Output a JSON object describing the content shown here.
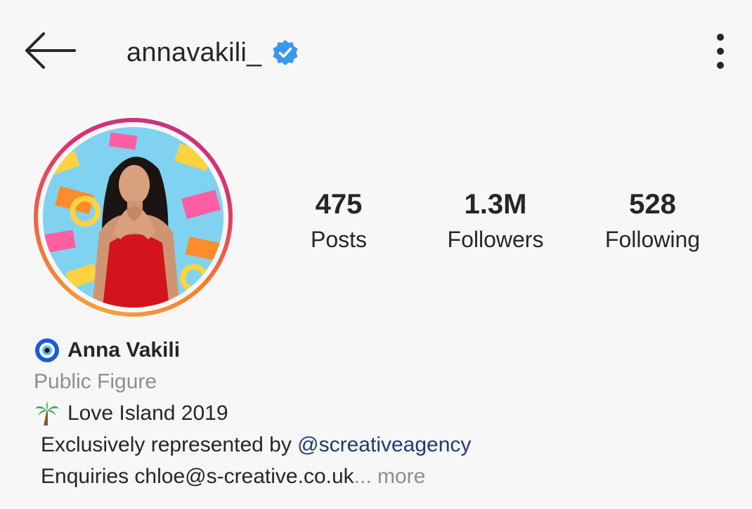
{
  "header": {
    "username": "annavakili_",
    "verified": true,
    "back_icon": "arrow-left-icon",
    "menu_icon": "more-vertical-icon",
    "verified_color": "#3897f0"
  },
  "profile": {
    "avatar_alt": "Anna Vakili profile photo",
    "story_ring_colors": [
      "#f9a03f",
      "#f06d3a",
      "#e1306c",
      "#c13584"
    ]
  },
  "stats": [
    {
      "value": "475",
      "label": "Posts"
    },
    {
      "value": "1.3M",
      "label": "Followers"
    },
    {
      "value": "528",
      "label": "Following"
    }
  ],
  "bio": {
    "name_emoji_icon": "nazar-amulet-icon",
    "name": "Anna Vakili",
    "category": "Public Figure",
    "line1_emoji_icon": "palm-tree-icon",
    "line1": "Love Island 2019",
    "line2_prefix": "Exclusively represented by ",
    "line2_mention": "@screativeagency",
    "line3": "Enquiries chloe@s-creative.co.uk",
    "line3_more": "... more"
  }
}
